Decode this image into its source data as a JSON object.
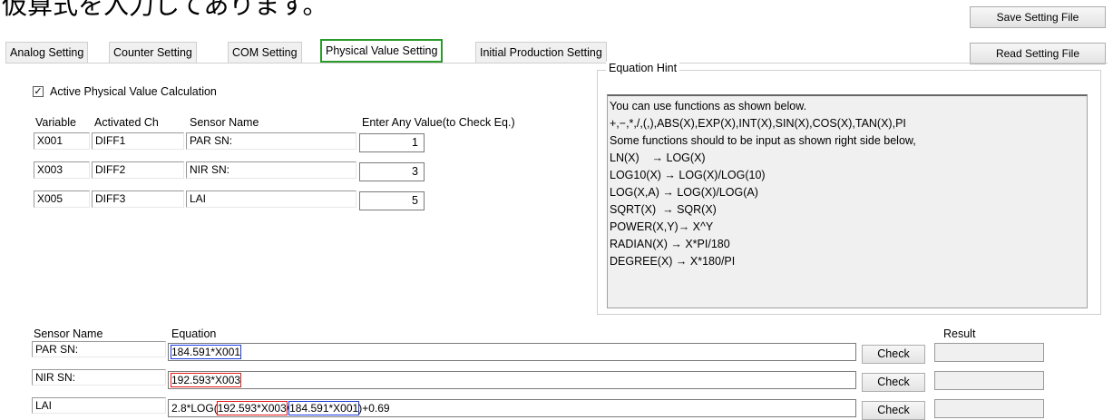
{
  "caption": "仮算式を入力してあります。",
  "buttons": {
    "save": "Save Setting File",
    "read": "Read Setting File"
  },
  "tabs": [
    "Analog Setting",
    "Counter Setting",
    "COM Setting",
    "Physical Value Setting",
    "Initial Production Setting"
  ],
  "active_calc": {
    "checked": true,
    "label": "Active Physical Value Calculation",
    "mark": "✓"
  },
  "var_table": {
    "headers": [
      "Variable",
      "Activated Ch",
      "Sensor Name",
      "Enter Any Value(to Check Eq.)"
    ],
    "rows": [
      {
        "variable": "X001",
        "channel": "DIFF1",
        "sensor": "PAR SN:",
        "value": "1"
      },
      {
        "variable": "X003",
        "channel": "DIFF2",
        "sensor": "NIR SN:",
        "value": "3"
      },
      {
        "variable": "X005",
        "channel": "DIFF3",
        "sensor": "LAI",
        "value": "5"
      }
    ]
  },
  "hint": {
    "title": "Equation Hint",
    "lines": [
      "You can use functions as shown below.",
      "+,−,*,/,(,),ABS(X),EXP(X),INT(X),SIN(X),COS(X),TAN(X),PI",
      "",
      "Some functions should to be input as shown right side below,",
      "LN(X)    → LOG(X)",
      "LOG10(X) → LOG(X)/LOG(10)",
      "LOG(X,A) → LOG(X)/LOG(A)",
      "SQRT(X)  → SQR(X)",
      "POWER(X,Y)→ X^Y",
      "RADIAN(X) → X*PI/180",
      "DEGREE(X) → X*180/PI"
    ]
  },
  "equations": {
    "headers": {
      "sensor": "Sensor Name",
      "equation": "Equation",
      "result": "Result"
    },
    "check_label": "Check",
    "rows": [
      {
        "sensor": "PAR SN:",
        "equation": "184.591*X001"
      },
      {
        "sensor": "NIR SN:",
        "equation": "192.593*X003"
      },
      {
        "sensor": "LAI",
        "eq_prefix": "2.8*LOG(",
        "eq_part1": "192.593*X003",
        "eq_mid": "/",
        "eq_part2": "184.591*X001",
        "eq_suffix": ")+0.69"
      }
    ]
  },
  "colors": {
    "active_tab_border": "#2a9a2a",
    "highlight_blue": "#1a3be0",
    "highlight_red": "#e01a1a"
  }
}
